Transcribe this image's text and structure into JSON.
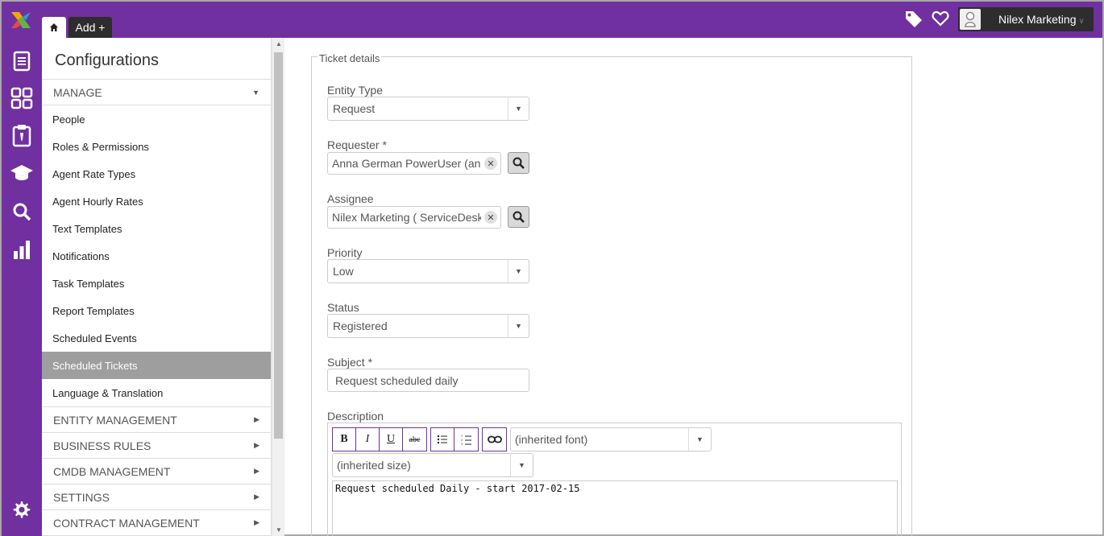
{
  "topbar": {
    "add_label": "Add +",
    "user_name": "Nilex Marketing",
    "icons": [
      "logo-icon",
      "home-icon",
      "tag-icon",
      "heart-icon",
      "user-avatar-icon"
    ]
  },
  "rail": {
    "icons": [
      "document-icon",
      "dashboard-icon",
      "clipboard-icon",
      "graduation-cap-icon",
      "search-icon",
      "bar-chart-icon",
      "gear-icon"
    ]
  },
  "sidebar": {
    "title": "Configurations",
    "manage_label": "MANAGE",
    "items": [
      {
        "label": "People"
      },
      {
        "label": "Roles & Permissions"
      },
      {
        "label": "Agent Rate Types"
      },
      {
        "label": "Agent Hourly Rates"
      },
      {
        "label": "Text Templates"
      },
      {
        "label": "Notifications"
      },
      {
        "label": "Task Templates"
      },
      {
        "label": "Report Templates"
      },
      {
        "label": "Scheduled Events"
      },
      {
        "label": "Scheduled Tickets"
      },
      {
        "label": "Language & Translation"
      }
    ],
    "active_item": "Scheduled Tickets",
    "sections": [
      {
        "label": "ENTITY MANAGEMENT"
      },
      {
        "label": "BUSINESS RULES"
      },
      {
        "label": "CMDB MANAGEMENT"
      },
      {
        "label": "SETTINGS"
      },
      {
        "label": "CONTRACT MANAGEMENT"
      }
    ]
  },
  "form": {
    "legend": "Ticket details",
    "entity_type": {
      "label": "Entity Type",
      "value": "Request"
    },
    "requester": {
      "label": "Requester *",
      "value": "Anna German PowerUser (anna"
    },
    "assignee": {
      "label": "Assignee",
      "value": "Nilex Marketing ( ServiceDesk )"
    },
    "priority": {
      "label": "Priority",
      "value": "Low"
    },
    "status": {
      "label": "Status",
      "value": "Registered"
    },
    "subject": {
      "label": "Subject *",
      "value": "Request scheduled daily"
    },
    "description": {
      "label": "Description",
      "toolbar": {
        "bold": "B",
        "italic": "I",
        "underline": "U",
        "strike": "abc"
      },
      "font": "(inherited font)",
      "size": "(inherited size)",
      "content": "Request scheduled Daily - start 2017-02-15"
    }
  },
  "colors": {
    "brand": "#7030a0",
    "active_item": "#9e9e9e",
    "dark": "#2d2d2d"
  }
}
